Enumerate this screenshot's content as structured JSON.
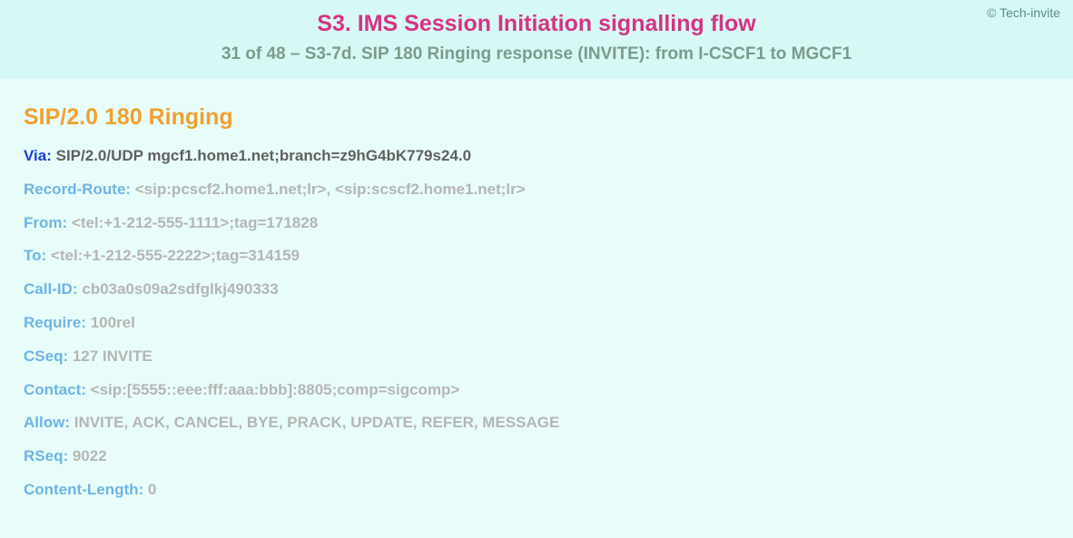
{
  "copyright": "© Tech-invite",
  "title": "S3. IMS Session Initiation signalling flow",
  "subtitle": "31 of 48 – S3-7d. SIP 180 Ringing response (INVITE): from I-CSCF1 to MGCF1",
  "sip_status": "SIP/2.0 180 Ringing",
  "via": {
    "name": "Via",
    "value": "SIP/2.0/UDP mgcf1.home1.net;branch=z9hG4bK779s24.0"
  },
  "headers": [
    {
      "name": "Record-Route",
      "value": "<sip:pcscf2.home1.net;lr>, <sip:scscf2.home1.net;lr>"
    },
    {
      "name": "From",
      "value": "<tel:+1-212-555-1111>;tag=171828"
    },
    {
      "name": "To",
      "value": "<tel:+1-212-555-2222>;tag=314159"
    },
    {
      "name": "Call-ID",
      "value": "cb03a0s09a2sdfglkj490333"
    },
    {
      "name": "Require",
      "value": "100rel"
    },
    {
      "name": "CSeq",
      "value": "127 INVITE"
    },
    {
      "name": "Contact",
      "value": "<sip:[5555::eee:fff:aaa:bbb]:8805;comp=sigcomp>"
    },
    {
      "name": "Allow",
      "value": "INVITE, ACK, CANCEL, BYE, PRACK, UPDATE, REFER, MESSAGE"
    },
    {
      "name": "RSeq",
      "value": "9022"
    },
    {
      "name": "Content-Length",
      "value": "0"
    }
  ]
}
